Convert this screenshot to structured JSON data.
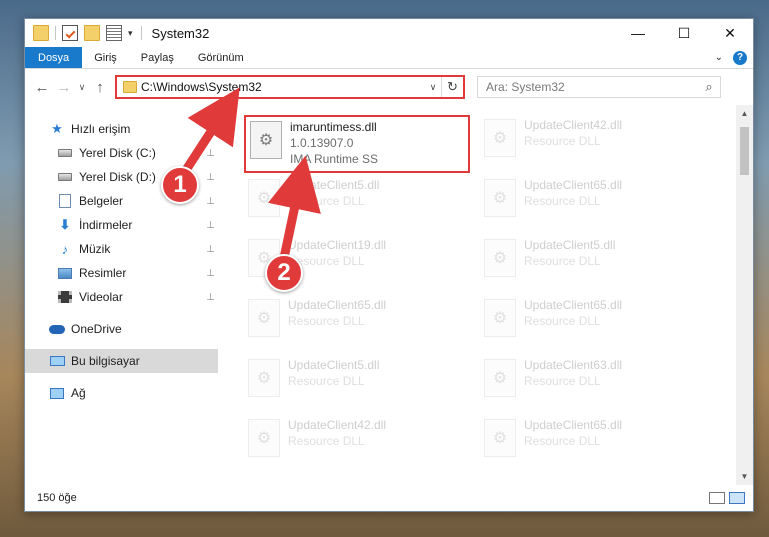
{
  "window": {
    "title": "System32",
    "controls": {
      "minimize": "—",
      "maximize": "☐",
      "close": "✕"
    }
  },
  "ribbon": {
    "tabs": [
      {
        "label": "Dosya",
        "active": true
      },
      {
        "label": "Giriş"
      },
      {
        "label": "Paylaş"
      },
      {
        "label": "Görünüm"
      }
    ],
    "help": "?",
    "expand": "⌄"
  },
  "navigation": {
    "back": "←",
    "forward": "→",
    "recent": "∨",
    "up": "↑",
    "address_path": "C:\\Windows\\System32",
    "address_dropdown": "∨",
    "refresh": "↻",
    "search_placeholder": "Ara: System32",
    "search_icon": "⌕"
  },
  "sidebar": {
    "items": [
      {
        "label": "Hızlı erişim",
        "icon": "star-icon",
        "glyph": "★"
      },
      {
        "label": "Yerel Disk (C:)",
        "icon": "drive-icon",
        "pinned": true
      },
      {
        "label": "Yerel Disk (D:)",
        "icon": "drive-icon",
        "pinned": true
      },
      {
        "label": "Belgeler",
        "icon": "documents-icon",
        "pinned": true
      },
      {
        "label": "İndirmeler",
        "icon": "downloads-icon",
        "glyph": "⬇",
        "pinned": true
      },
      {
        "label": "Müzik",
        "icon": "music-icon",
        "glyph": "♪",
        "pinned": true
      },
      {
        "label": "Resimler",
        "icon": "pictures-icon",
        "pinned": true
      },
      {
        "label": "Videolar",
        "icon": "videos-icon",
        "pinned": true
      },
      {
        "label": "OneDrive",
        "icon": "onedrive-icon"
      },
      {
        "label": "Bu bilgisayar",
        "icon": "this-pc-icon",
        "selected": true
      },
      {
        "label": "Ağ",
        "icon": "network-icon"
      }
    ],
    "pin_glyph": "📌"
  },
  "files": [
    {
      "name": "imaruntimess.dll",
      "line2": "1.0.13907.0",
      "line3": "IMA Runtime SS",
      "highlighted": true
    },
    {
      "name": "UpdateClient42.dll",
      "line2": "Resource DLL"
    },
    {
      "name": "UpdateClient5.dll",
      "line2": "Resource DLL"
    },
    {
      "name": "UpdateClient65.dll",
      "line2": "Resource DLL"
    },
    {
      "name": "UpdateClient19.dll",
      "line2": "Resource DLL"
    },
    {
      "name": "UpdateClient5.dll",
      "line2": "Resource DLL"
    },
    {
      "name": "UpdateClient65.dll",
      "line2": "Resource DLL"
    },
    {
      "name": "UpdateClient65.dll",
      "line2": "Resource DLL"
    },
    {
      "name": "UpdateClient5.dll",
      "line2": "Resource DLL"
    },
    {
      "name": "UpdateClient63.dll",
      "line2": "Resource DLL"
    },
    {
      "name": "UpdateClient42.dll",
      "line2": "Resource DLL"
    },
    {
      "name": "UpdateClient65.dll",
      "line2": "Resource DLL"
    }
  ],
  "status": {
    "count": "150 öğe"
  },
  "annotations": {
    "marker1": "1",
    "marker2": "2"
  },
  "colors": {
    "accent": "#1979ca",
    "highlight": "#e03a3a"
  }
}
